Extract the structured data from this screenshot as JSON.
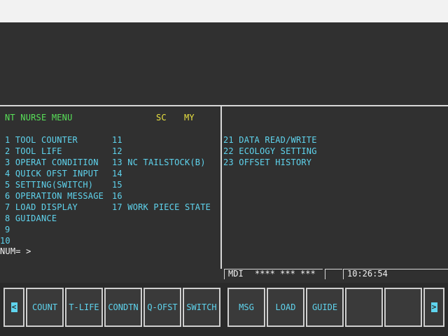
{
  "header": {
    "title": "NT NURSE MENU",
    "mode_sc": "SC",
    "mode_my": "MY"
  },
  "menu_left": [
    "1 TOOL COUNTER",
    "2 TOOL LIFE",
    "3 OPERAT CONDITION",
    "4 QUICK OFST INPUT",
    "5 SETTING(SWITCH)",
    "6 OPERATION MESSAGE",
    "7 LOAD DISPLAY",
    "8 GUIDANCE",
    "9",
    "10"
  ],
  "menu_middle": [
    "11",
    "12",
    "13 NC TAILSTOCK(B)",
    "14",
    "15",
    "16",
    "17 WORK PIECE STATE"
  ],
  "menu_right": [
    "21 DATA READ/WRITE",
    "22 ECOLOGY SETTING",
    "23 OFFSET HISTORY"
  ],
  "input": {
    "prompt": "NUM= >"
  },
  "status": {
    "mode": "MDI",
    "stars": "**** *** ***",
    "time": "10:26:54"
  },
  "softkeys": {
    "prev": "<",
    "next": ">",
    "keys": [
      "COUNT",
      "T-LIFE",
      "CONDTN",
      "Q-OFST",
      "SWITCH",
      "MSG",
      "LOAD",
      "GUIDE",
      "",
      ""
    ]
  },
  "colors": {
    "text": "#5fd4ee",
    "title": "#58e058",
    "mode": "#e8e040",
    "background": "#303030"
  }
}
